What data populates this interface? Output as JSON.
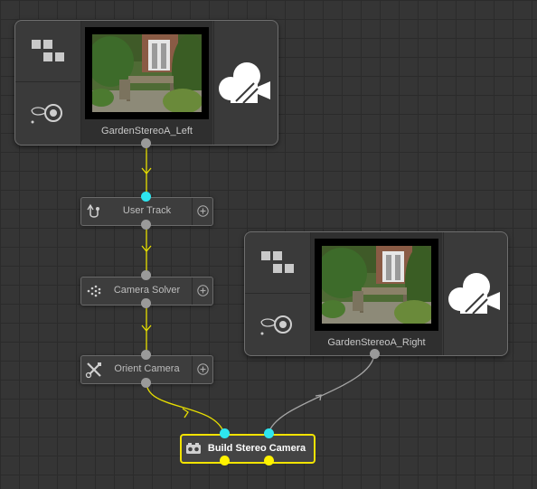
{
  "graph": {
    "source_left": {
      "label": "GardenStereoA_Left"
    },
    "source_right": {
      "label": "GardenStereoA_Right"
    },
    "user_track": {
      "label": "User Track"
    },
    "camera_solver": {
      "label": "Camera Solver"
    },
    "orient_camera": {
      "label": "Orient Camera"
    },
    "build_stereo_camera": {
      "label": "Build Stereo Camera"
    }
  },
  "icons": {
    "grid_blocks": "blocks-icon",
    "lens": "lens-target-icon",
    "camera": "movie-camera-icon",
    "track": "user-track-icon",
    "solver": "camera-solver-icon",
    "orient": "tools-icon",
    "add": "add-circle-icon",
    "stereo": "stereo-camera-icon"
  },
  "colors": {
    "active_wire": "#e8df00",
    "inactive_wire": "#a5a5a5",
    "port_active": "#fff200",
    "port_connected": "#2ee6f0",
    "selection_border": "#f2e300"
  }
}
